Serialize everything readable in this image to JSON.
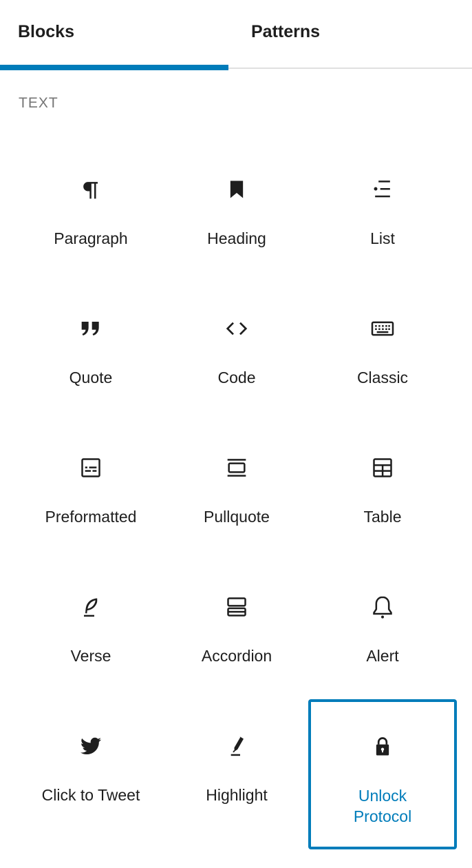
{
  "tabs": {
    "blocks": "Blocks",
    "patterns": "Patterns"
  },
  "section": {
    "title": "TEXT"
  },
  "blocks": [
    {
      "label": "Paragraph",
      "icon": "paragraph-icon"
    },
    {
      "label": "Heading",
      "icon": "bookmark-icon"
    },
    {
      "label": "List",
      "icon": "list-icon"
    },
    {
      "label": "Quote",
      "icon": "quote-icon"
    },
    {
      "label": "Code",
      "icon": "code-icon"
    },
    {
      "label": "Classic",
      "icon": "keyboard-icon"
    },
    {
      "label": "Preformatted",
      "icon": "preformatted-icon"
    },
    {
      "label": "Pullquote",
      "icon": "pullquote-icon"
    },
    {
      "label": "Table",
      "icon": "table-icon"
    },
    {
      "label": "Verse",
      "icon": "feather-icon"
    },
    {
      "label": "Accordion",
      "icon": "accordion-icon"
    },
    {
      "label": "Alert",
      "icon": "bell-icon"
    },
    {
      "label": "Click to Tweet",
      "icon": "twitter-bird-icon"
    },
    {
      "label": "Highlight",
      "icon": "highlighter-icon"
    },
    {
      "label": "Unlock\nProtocol",
      "icon": "lock-icon",
      "selected": true
    }
  ],
  "colors": {
    "accent": "#007cba",
    "text": "#1e1e1e",
    "muted": "#757575",
    "divider": "#e0e0e0"
  }
}
